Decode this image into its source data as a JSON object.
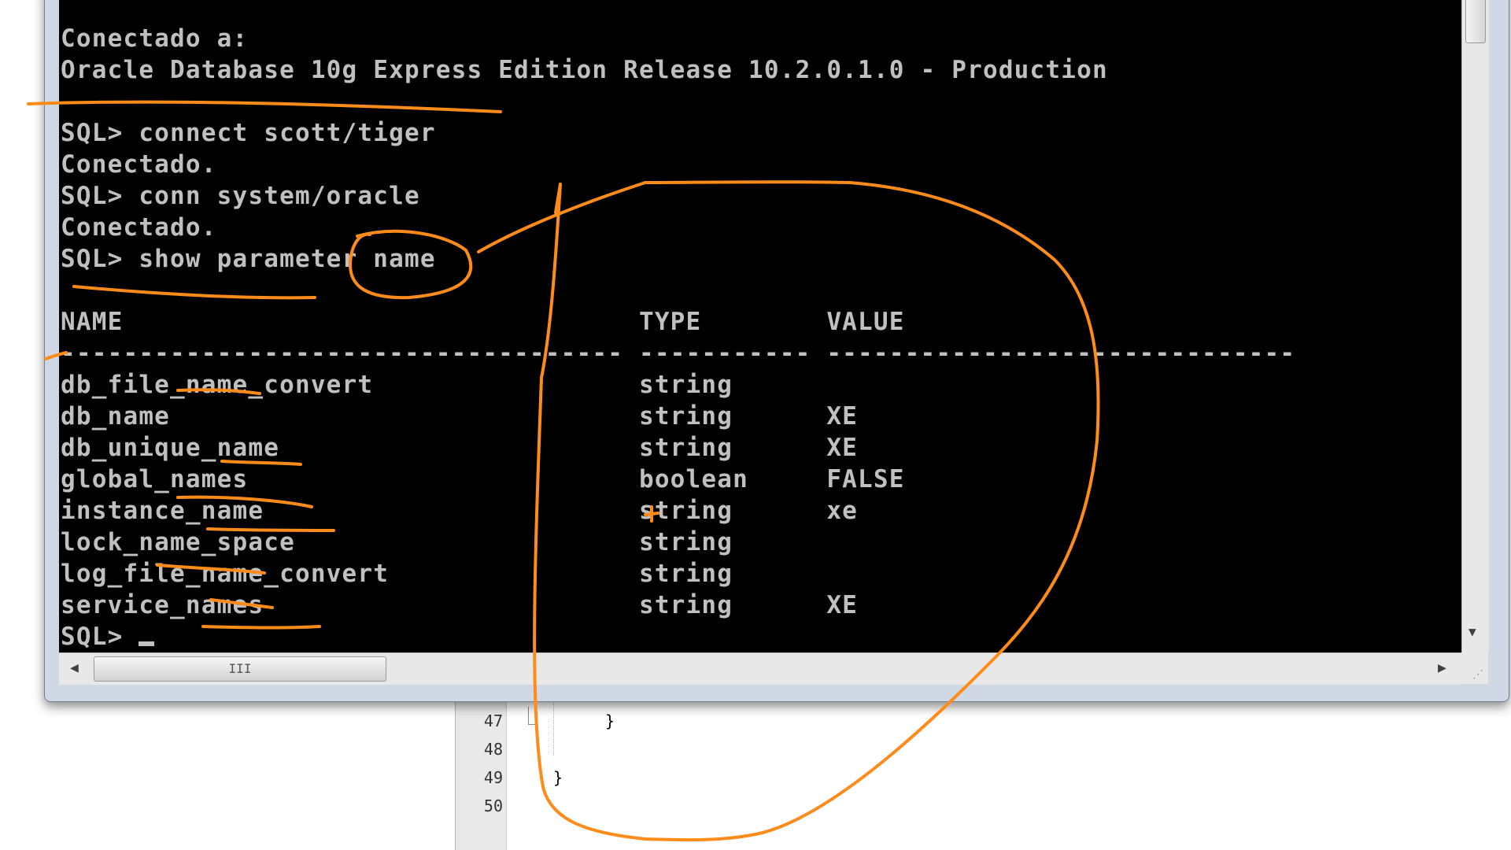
{
  "console": {
    "lines": [
      "Conectado a:",
      "Oracle Database 10g Express Edition Release 10.2.0.1.0 - Production",
      "",
      "SQL> connect scott/tiger",
      "Conectado.",
      "SQL> conn system/oracle",
      "Conectado.",
      "SQL> show parameter name",
      "",
      "NAME                                 TYPE        VALUE",
      "------------------------------------ ----------- ------------------------------",
      "db_file_name_convert                 string",
      "db_name                              string      XE",
      "db_unique_name                       string      XE",
      "global_names                         boolean     FALSE",
      "instance_name                        string      xe",
      "lock_name_space                      string",
      "log_file_name_convert                string",
      "service_names                        string      XE"
    ],
    "prompt": "SQL> "
  },
  "editor": {
    "line_numbers": [
      "47",
      "48",
      "49",
      "50"
    ],
    "code_line_47": "}",
    "code_line_49": "}"
  },
  "scrollbar": {
    "h_thumb_grip": "III"
  },
  "annotation_color": "#ff8c1a"
}
